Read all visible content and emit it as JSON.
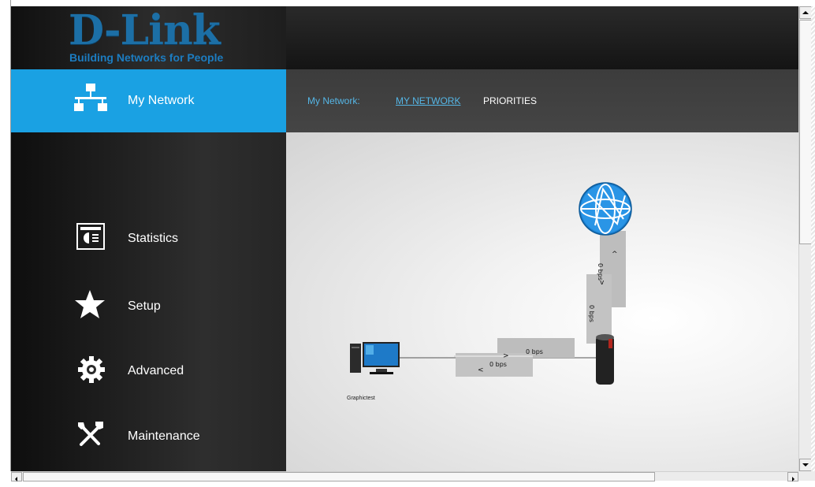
{
  "brand": {
    "logo_text": "D-Link",
    "tagline": "Building Networks for People",
    "logo_color": "#1c6fa6",
    "accent_color": "#1aa1e3"
  },
  "sidebar": {
    "items": [
      {
        "label": "My Network",
        "icon": "network-icon",
        "active": true
      },
      {
        "label": "Statistics",
        "icon": "statistics-icon",
        "active": false
      },
      {
        "label": "Setup",
        "icon": "star-icon",
        "active": false
      },
      {
        "label": "Advanced",
        "icon": "gear-icon",
        "active": false
      },
      {
        "label": "Maintenance",
        "icon": "tools-icon",
        "active": false
      }
    ]
  },
  "subnav": {
    "prefix": "My Network:",
    "tabs": [
      {
        "label": "MY NETWORK",
        "active": true
      },
      {
        "label": "PRIORITIES",
        "active": false
      }
    ]
  },
  "map": {
    "client_name": "Graphictest",
    "links": [
      {
        "up": "0 bps",
        "down": "0 bps"
      },
      {
        "up": "0 bps",
        "down": "0 bps"
      }
    ]
  }
}
